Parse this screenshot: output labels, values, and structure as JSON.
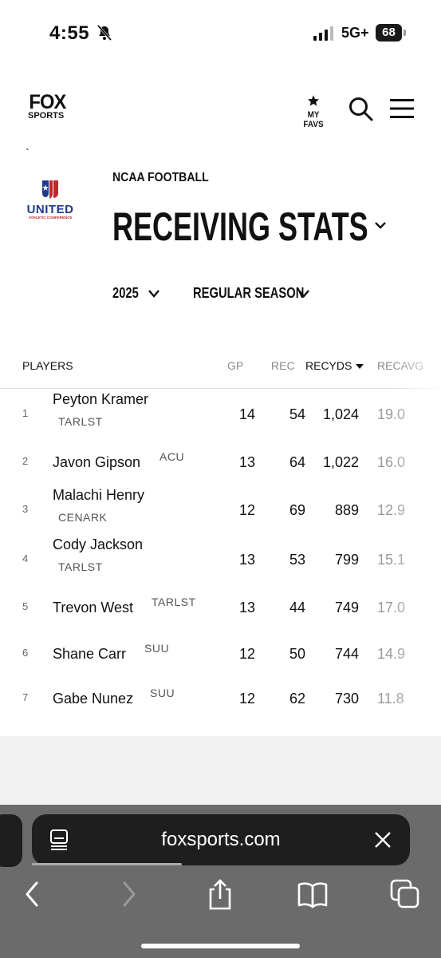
{
  "status": {
    "time": "4:55",
    "network": "5G+",
    "battery": "68"
  },
  "header": {
    "logo_line1": "FOX",
    "logo_line2": "SPORTS",
    "favs_label": "MY FAVS"
  },
  "page": {
    "tick": "`",
    "conference_logo": {
      "name": "UNITED",
      "subtitle": "ATHLETIC CONFERENCE"
    },
    "league": "NCAA FOOTBALL",
    "title": "RECEIVING STATS",
    "season": "2025",
    "season_type": "REGULAR SEASON"
  },
  "table": {
    "headers": {
      "players": "PLAYERS",
      "gp": "GP",
      "rec": "REC",
      "recyds": "RECYDS",
      "recavg": "RECAVG"
    },
    "rows": [
      {
        "rank": "1",
        "name": "Peyton Kramer",
        "team": "TARLST",
        "gp": "14",
        "rec": "54",
        "recyds": "1,024",
        "recavg": "19.0"
      },
      {
        "rank": "2",
        "name": "Javon Gipson",
        "team": "ACU",
        "gp": "13",
        "rec": "64",
        "recyds": "1,022",
        "recavg": "16.0"
      },
      {
        "rank": "3",
        "name": "Malachi Henry",
        "team": "CENARK",
        "gp": "12",
        "rec": "69",
        "recyds": "889",
        "recavg": "12.9"
      },
      {
        "rank": "4",
        "name": "Cody Jackson",
        "team": "TARLST",
        "gp": "13",
        "rec": "53",
        "recyds": "799",
        "recavg": "15.1"
      },
      {
        "rank": "5",
        "name": "Trevon West",
        "team": "TARLST",
        "gp": "13",
        "rec": "44",
        "recyds": "749",
        "recavg": "17.0"
      },
      {
        "rank": "6",
        "name": "Shane Carr",
        "team": "SUU",
        "gp": "12",
        "rec": "50",
        "recyds": "744",
        "recavg": "14.9"
      },
      {
        "rank": "7",
        "name": "Gabe Nunez",
        "team": "SUU",
        "gp": "12",
        "rec": "62",
        "recyds": "730",
        "recavg": "11.8"
      }
    ]
  },
  "browser": {
    "url": "foxsports.com"
  }
}
